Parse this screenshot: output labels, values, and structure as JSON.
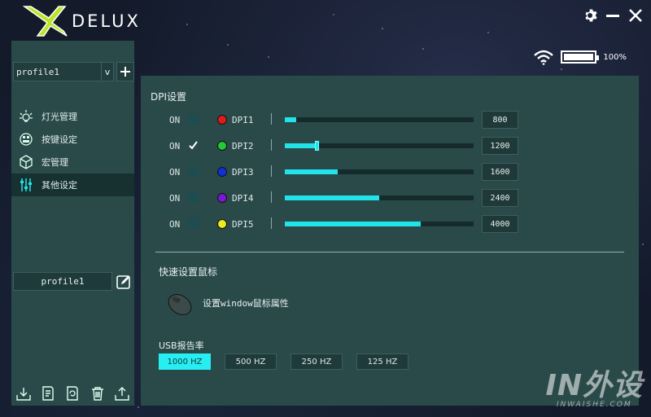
{
  "header": {
    "brand": "DELUX"
  },
  "status": {
    "battery_text": "100%",
    "battery_level": 1.0
  },
  "sidebar": {
    "profile_selected": "profile1",
    "dropdown_arrow": "v",
    "items": [
      {
        "label": "灯光管理",
        "icon": "sun-icon"
      },
      {
        "label": "按键设定",
        "icon": "mouse-buttons-icon"
      },
      {
        "label": "宏管理",
        "icon": "cube-icon"
      },
      {
        "label": "其他设定",
        "icon": "sliders-icon",
        "active": true
      }
    ],
    "profile_name": "profile1",
    "bottom_icons": [
      "import-icon",
      "document-icon",
      "refresh-icon",
      "trash-icon",
      "export-icon"
    ]
  },
  "dpi": {
    "title": "DPI设置",
    "rows": [
      {
        "on": "ON",
        "checked": false,
        "color": "#e11b1b",
        "label": "DPI1",
        "value": "800",
        "level": 0.06
      },
      {
        "on": "ON",
        "checked": true,
        "color": "#22c93a",
        "label": "DPI2",
        "value": "1200",
        "level": 0.17
      },
      {
        "on": "ON",
        "checked": false,
        "color": "#1030d8",
        "label": "DPI3",
        "value": "1600",
        "level": 0.28
      },
      {
        "on": "ON",
        "checked": false,
        "color": "#7a18d6",
        "label": "DPI4",
        "value": "2400",
        "level": 0.5
      },
      {
        "on": "ON",
        "checked": false,
        "color": "#f0e820",
        "label": "DPI5",
        "value": "4000",
        "level": 0.72
      }
    ]
  },
  "quick": {
    "title": "快速设置鼠标",
    "mouse_settings": "设置window鼠标属性"
  },
  "usb": {
    "title": "USB报告率",
    "options": [
      {
        "label": "1000 HZ",
        "active": true
      },
      {
        "label": "500 HZ"
      },
      {
        "label": "250 HZ"
      },
      {
        "label": "125 HZ"
      }
    ]
  },
  "watermark": {
    "big": "IN外设",
    "small": "INWAISHE.COM"
  },
  "accent": "#22e3ea"
}
